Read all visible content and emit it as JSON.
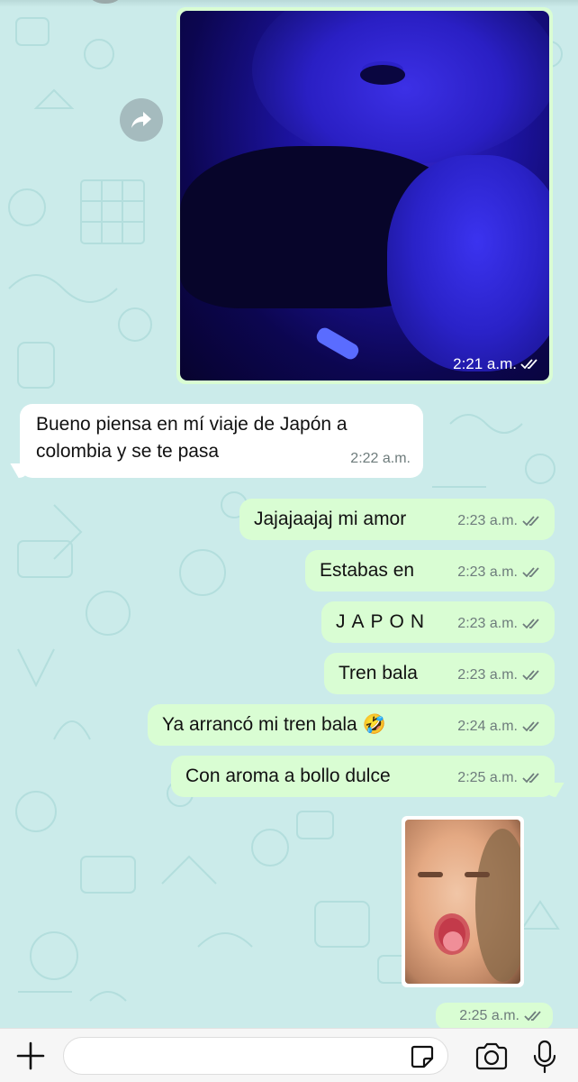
{
  "chat": {
    "photo_message": {
      "time": "2:21 a.m.",
      "status": "read-double-check-icon"
    },
    "incoming_message": {
      "text": "Bueno piensa en mí viaje de Japón a colombia y se te pasa",
      "time": "2:22 a.m."
    },
    "outgoing_messages": [
      {
        "text": "Jajajaajaj mi amor",
        "time": "2:23 a.m."
      },
      {
        "text": "Estabas en",
        "time": "2:23 a.m."
      },
      {
        "text": "JAPON",
        "time": "2:23 a.m."
      },
      {
        "text": "Tren bala",
        "time": "2:23 a.m."
      },
      {
        "text": "Ya arrancó mi tren bala 🤣",
        "time": "2:24 a.m."
      },
      {
        "text": "Con aroma a bollo dulce",
        "time": "2:25 a.m."
      }
    ],
    "sticker_message": {
      "time": "2:25 a.m."
    }
  },
  "composer": {
    "input_value": "",
    "icons": [
      "plus-icon",
      "sticker-icon",
      "camera-icon",
      "microphone-icon"
    ]
  },
  "colors": {
    "wallpaper": "#cbebea",
    "outgoing_bubble": "#d9fdd3",
    "incoming_bubble": "#ffffff",
    "meta_text": "#6e7c7c"
  }
}
